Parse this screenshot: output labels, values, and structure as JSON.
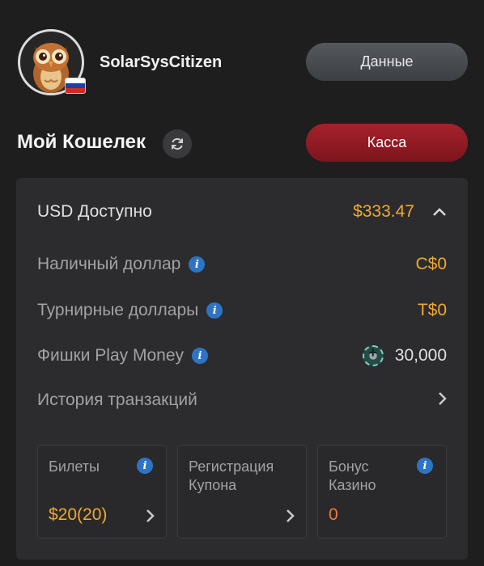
{
  "profile": {
    "username": "SolarSysCitizen",
    "flag_colors": [
      "#ffffff",
      "#1c3fa8",
      "#d52b1e"
    ]
  },
  "header": {
    "data_button_label": "Данные",
    "cashier_button_label": "Касса",
    "wallet_title": "Мой Кошелек"
  },
  "wallet": {
    "available_label": "USD Доступно",
    "available_value": "$333.47",
    "rows": [
      {
        "label": "Наличный доллар",
        "value": "C$0"
      },
      {
        "label": "Турнирные доллары",
        "value": "T$0"
      },
      {
        "label": "Фишки Play Money",
        "value": "30,000"
      }
    ],
    "history_label": "История транзакций"
  },
  "cards": {
    "tickets": {
      "title": "Билеты",
      "value": "$20(20)"
    },
    "coupon": {
      "title_line1": "Регистрация",
      "title_line2": "Купона"
    },
    "casino": {
      "title_line1": "Бонус",
      "title_line2": "Казино",
      "value": "0"
    }
  },
  "icons": {
    "refresh": "refresh-icon",
    "info": "info-icon",
    "chevron_up": "chevron-up-icon",
    "chevron_right": "chevron-right-icon",
    "chip": "play-money-chip-icon"
  },
  "colors": {
    "accent_gold": "#f1a830",
    "cashier_red": "#a5222c",
    "info_blue": "#2d74c4"
  }
}
